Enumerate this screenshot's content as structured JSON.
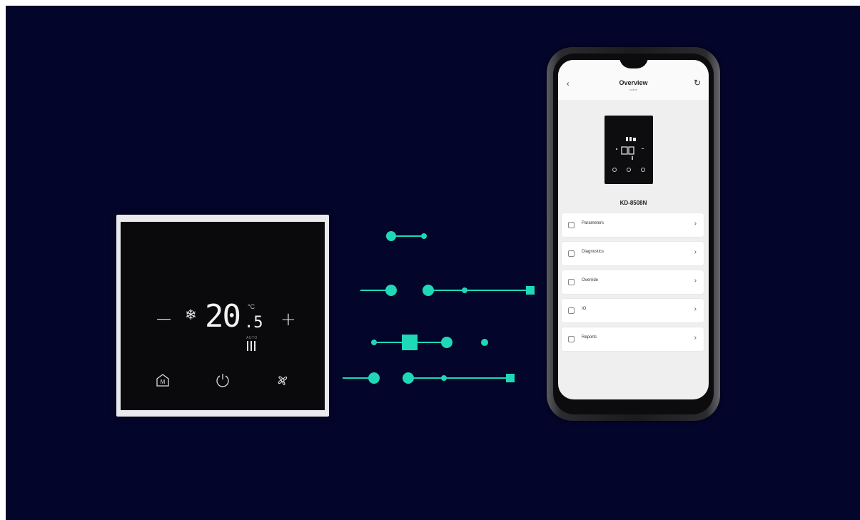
{
  "thermostat": {
    "minus": "−",
    "plus": "+",
    "mode_icon": "snowflake-icon",
    "temperature_main": "20",
    "temperature_decimal": ".5",
    "unit": "°C",
    "fan_label": "AUTO",
    "buttons": [
      "mode-icon",
      "power-icon",
      "fan-icon"
    ]
  },
  "colors": {
    "background": "#04052a",
    "accent": "#1fd8b8",
    "screen": "#efefef"
  },
  "phone": {
    "back": "‹",
    "title": "Overview",
    "subtitle": "online",
    "refresh": "↻",
    "model": "KD-8508N",
    "menu": [
      {
        "label": "Parameters",
        "icon": "parameters-icon",
        "chevron": "›"
      },
      {
        "label": "Diagnostics",
        "icon": "diagnostics-icon",
        "chevron": "›"
      },
      {
        "label": "Override",
        "icon": "override-icon",
        "chevron": "›"
      },
      {
        "label": "IO",
        "icon": "io-icon",
        "chevron": "›"
      },
      {
        "label": "Reports",
        "icon": "reports-icon",
        "chevron": "›"
      }
    ]
  }
}
